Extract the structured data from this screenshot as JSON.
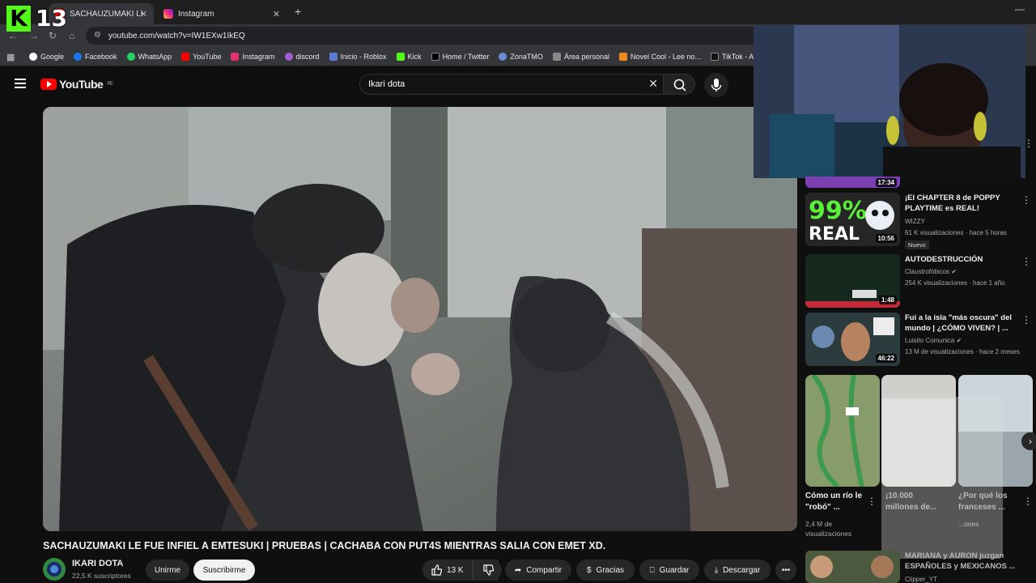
{
  "browser": {
    "tabs": [
      {
        "title": "SACHAUZUMAKI LE FUE IN..."
      },
      {
        "title": "Instagram"
      }
    ],
    "url": "youtube.com/watch?v=IW1EXw1IkEQ",
    "bookmarks": [
      "Google",
      "Facebook",
      "WhatsApp",
      "YouTube",
      "Instagram",
      "discord",
      "Inicio - Roblox",
      "Kick",
      "Home / Twitter",
      "ZonaTMO",
      "Área personal",
      "Novel Cool - Lee no...",
      "TikTok - Alegra tu"
    ]
  },
  "overlay": {
    "kick_count": "13"
  },
  "youtube": {
    "logo": "YouTube",
    "region": "PE",
    "search_value": "Ikari dota"
  },
  "video": {
    "title": "SACHAUZUMAKI LE FUE INFIEL A EMTESUKI | PRUEBAS | CACHABA CON PUT4S MIENTRAS SALIA CON EMET XD.",
    "channel": "IKARI DOTA",
    "subscribers": "22,5 K suscriptores",
    "join_label": "Unirme",
    "subscribe_label": "Suscribirme",
    "likes": "13 K",
    "share_label": "Compartir",
    "thanks_label": "Gracias",
    "save_label": "Guardar",
    "download_label": "Descargar"
  },
  "sidebar": {
    "partial_top_duration": "17:34",
    "items": [
      {
        "title": "¡El CHAPTER 8 de POPPY PLAYTIME es REAL!",
        "channel": "WIZZY",
        "meta": "61 K visualizaciones · hace 5 horas",
        "badge": "Nuevo",
        "duration": "10:56",
        "thumb_text": "99% REAL"
      },
      {
        "title": "AUTODESTRUCCIÓN",
        "channel": "Claustrofóbicos",
        "meta": "254 K visualizaciones · hace 1 año",
        "duration": "1:48"
      },
      {
        "title": "Fui a la isla \"más oscura\" del mundo | ¿CÓMO VIVEN? | ...",
        "channel": "Luisito Comunica",
        "meta": "13 M de visualizaciones · hace 2 meses",
        "duration": "46:22"
      }
    ],
    "shorts": [
      {
        "title": "Cómo un río le \"robó\" ...",
        "views": "2,4 M de visualizaciones"
      },
      {
        "title": "¡10.000 millones de...",
        "views": ""
      },
      {
        "title": "¿Por qué los franceses ...",
        "views": "...ones"
      }
    ],
    "bottom_item": {
      "title": "MARIANA y AURON juzgan ESPAÑOLES y MEXICANOS ...",
      "channel": "Clipper_YT"
    }
  }
}
